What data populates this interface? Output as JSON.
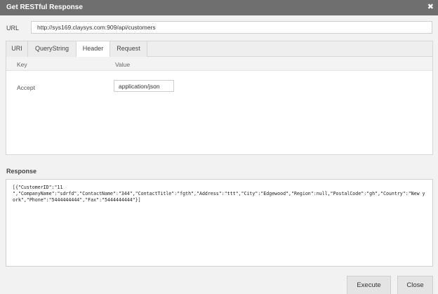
{
  "window": {
    "title": "Get RESTful Response",
    "close_glyph": "✖"
  },
  "url": {
    "label": "URL",
    "value": "http://sys169.claysys.com:909/api/customers"
  },
  "tabs": [
    {
      "label": "URI"
    },
    {
      "label": "QueryString"
    },
    {
      "label": "Header",
      "active": true
    },
    {
      "label": "Request"
    }
  ],
  "header_grid": {
    "columns": {
      "key": "Key",
      "value": "Value"
    },
    "rows": [
      {
        "key": "Accept",
        "value": "application/json"
      }
    ]
  },
  "response": {
    "label": "Response",
    "body": "[{\"CustomerID\":\"11\n\",\"CompanyName\":\"sdrfd\",\"ContactName\":\"344\",\"ContactTitle\":\"fgth\",\"Address\":\"ttt\",\"City\":\"Edgewood\",\"Region\":null,\"PostalCode\":\"gh\",\"Country\":\"New york\",\"Phone\":\"5444444444\",\"Fax\":\"5444444444\"}]"
  },
  "buttons": {
    "execute": "Execute",
    "close": "Close"
  },
  "colors": {
    "titlebar": "#6f6f6f",
    "background": "#f2f2f2"
  }
}
